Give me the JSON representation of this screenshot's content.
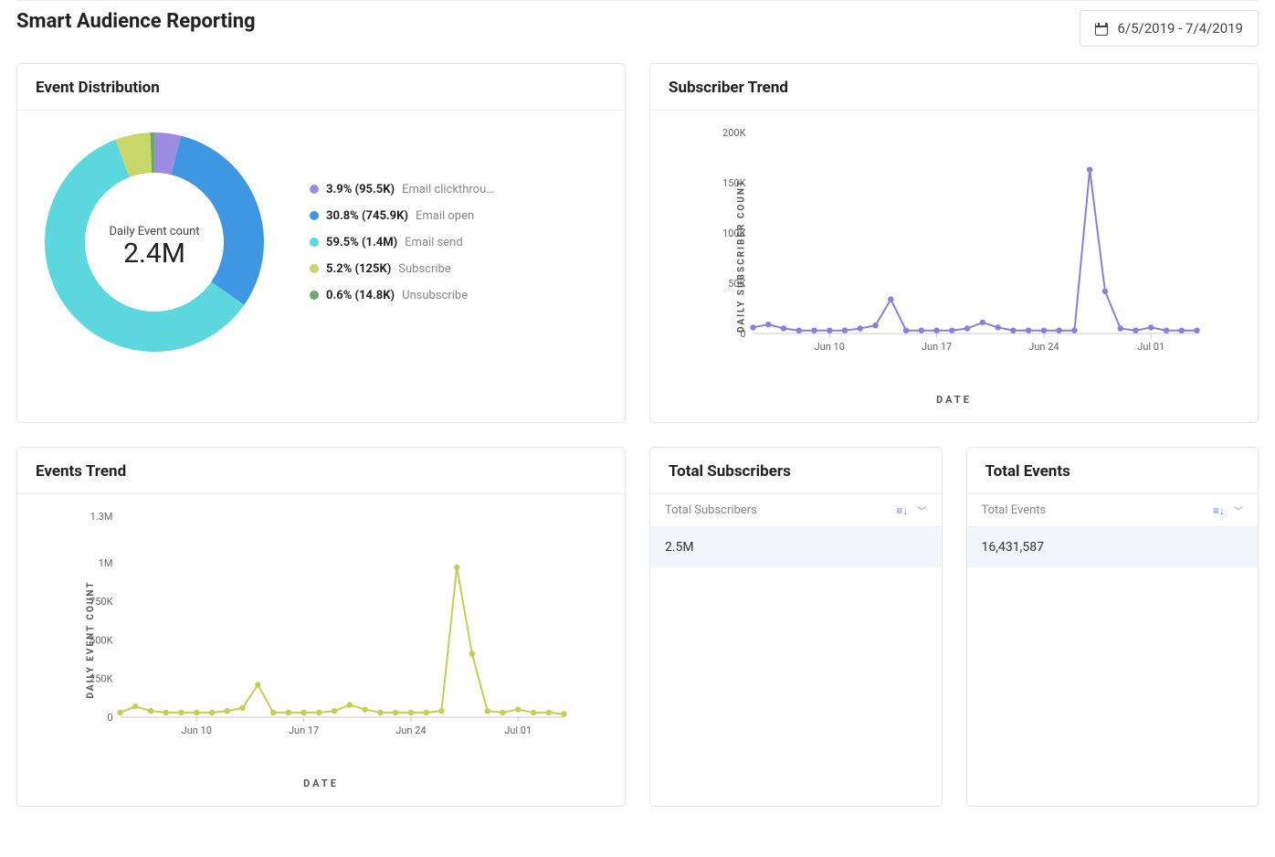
{
  "page_title": "Smart Audience Reporting",
  "date_range": "6/5/2019 - 7/4/2019",
  "donut": {
    "title": "Event Distribution",
    "center_label": "Daily Event count",
    "center_value": "2.4M",
    "legend": [
      {
        "pct_count": "3.9% (95.5K)",
        "name": "Email clickthrou…",
        "color": "#9b8ce0"
      },
      {
        "pct_count": "30.8% (745.9K)",
        "name": "Email open",
        "color": "#3e97e0"
      },
      {
        "pct_count": "59.5% (1.4M)",
        "name": "Email send",
        "color": "#5cd7dd"
      },
      {
        "pct_count": "5.2% (125K)",
        "name": "Subscribe",
        "color": "#c9d66a"
      },
      {
        "pct_count": "0.6% (14.8K)",
        "name": "Unsubscribe",
        "color": "#6fa86f"
      }
    ]
  },
  "subscriber_trend": {
    "title": "Subscriber Trend",
    "yaxis": "DAILY SUBSCRIBER COUNT",
    "xaxis": "DATE"
  },
  "events_trend": {
    "title": "Events Trend",
    "yaxis": "DAILY EVENT COUNT",
    "xaxis": "DATE"
  },
  "total_subscribers": {
    "title": "Total Subscribers",
    "column": "Total Subscribers",
    "value": "2.5M"
  },
  "total_events": {
    "title": "Total Events",
    "column": "Total Events",
    "value": "16,431,587"
  },
  "chart_data": [
    {
      "type": "pie",
      "title": "Event Distribution",
      "center_label": "Daily Event count",
      "center_value": "2.4M",
      "series": [
        {
          "name": "Email clickthrough",
          "pct": 3.9,
          "count_label": "95.5K",
          "color": "#9b8ce0"
        },
        {
          "name": "Email open",
          "pct": 30.8,
          "count_label": "745.9K",
          "color": "#3e97e0"
        },
        {
          "name": "Email send",
          "pct": 59.5,
          "count_label": "1.4M",
          "color": "#5cd7dd"
        },
        {
          "name": "Subscribe",
          "pct": 5.2,
          "count_label": "125K",
          "color": "#c9d66a"
        },
        {
          "name": "Unsubscribe",
          "pct": 0.6,
          "count_label": "14.8K",
          "color": "#6fa86f"
        }
      ]
    },
    {
      "type": "line",
      "title": "Subscriber Trend",
      "xlabel": "DATE",
      "ylabel": "DAILY SUBSCRIBER COUNT",
      "ylim": [
        0,
        200000
      ],
      "yticks": [
        0,
        50000,
        100000,
        150000,
        200000
      ],
      "ytick_labels": [
        "0",
        "50K",
        "100K",
        "150K",
        "200K"
      ],
      "xtick_labels": [
        "Jun 10",
        "Jun 17",
        "Jun 24",
        "Jul 01"
      ],
      "xtick_indices": [
        5,
        12,
        19,
        26
      ],
      "color": "#8a7fd9",
      "x": [
        "Jun 05",
        "Jun 06",
        "Jun 07",
        "Jun 08",
        "Jun 09",
        "Jun 10",
        "Jun 11",
        "Jun 12",
        "Jun 13",
        "Jun 14",
        "Jun 15",
        "Jun 16",
        "Jun 17",
        "Jun 18",
        "Jun 19",
        "Jun 20",
        "Jun 21",
        "Jun 22",
        "Jun 23",
        "Jun 24",
        "Jun 25",
        "Jun 26",
        "Jun 27",
        "Jun 28",
        "Jun 29",
        "Jun 30",
        "Jul 01",
        "Jul 02",
        "Jul 03",
        "Jul 04"
      ],
      "values": [
        6000,
        9000,
        5000,
        3000,
        3000,
        3000,
        3000,
        5000,
        8000,
        34000,
        3000,
        3000,
        3000,
        3000,
        5000,
        11000,
        6000,
        3000,
        3000,
        3000,
        3000,
        3000,
        163000,
        42000,
        5000,
        3000,
        6000,
        3000,
        3000,
        3000
      ]
    },
    {
      "type": "line",
      "title": "Events Trend",
      "xlabel": "DATE",
      "ylabel": "DAILY EVENT COUNT",
      "ylim": [
        0,
        1300000
      ],
      "yticks": [
        0,
        250000,
        500000,
        750000,
        1000000,
        1300000
      ],
      "ytick_labels": [
        "0",
        "250K",
        "500K",
        "750K",
        "1M",
        "1.3M"
      ],
      "xtick_labels": [
        "Jun 10",
        "Jun 17",
        "Jun 24",
        "Jul 01"
      ],
      "xtick_indices": [
        5,
        12,
        19,
        26
      ],
      "color": "#c3ce54",
      "x": [
        "Jun 05",
        "Jun 06",
        "Jun 07",
        "Jun 08",
        "Jun 09",
        "Jun 10",
        "Jun 11",
        "Jun 12",
        "Jun 13",
        "Jun 14",
        "Jun 15",
        "Jun 16",
        "Jun 17",
        "Jun 18",
        "Jun 19",
        "Jun 20",
        "Jun 21",
        "Jun 22",
        "Jun 23",
        "Jun 24",
        "Jun 25",
        "Jun 26",
        "Jun 27",
        "Jun 28",
        "Jun 29",
        "Jun 30",
        "Jul 01",
        "Jul 02",
        "Jul 03",
        "Jul 04"
      ],
      "values": [
        30000,
        70000,
        40000,
        30000,
        30000,
        30000,
        30000,
        40000,
        60000,
        210000,
        30000,
        30000,
        30000,
        30000,
        40000,
        80000,
        50000,
        30000,
        30000,
        30000,
        30000,
        40000,
        970000,
        410000,
        40000,
        30000,
        50000,
        30000,
        30000,
        20000
      ]
    }
  ]
}
